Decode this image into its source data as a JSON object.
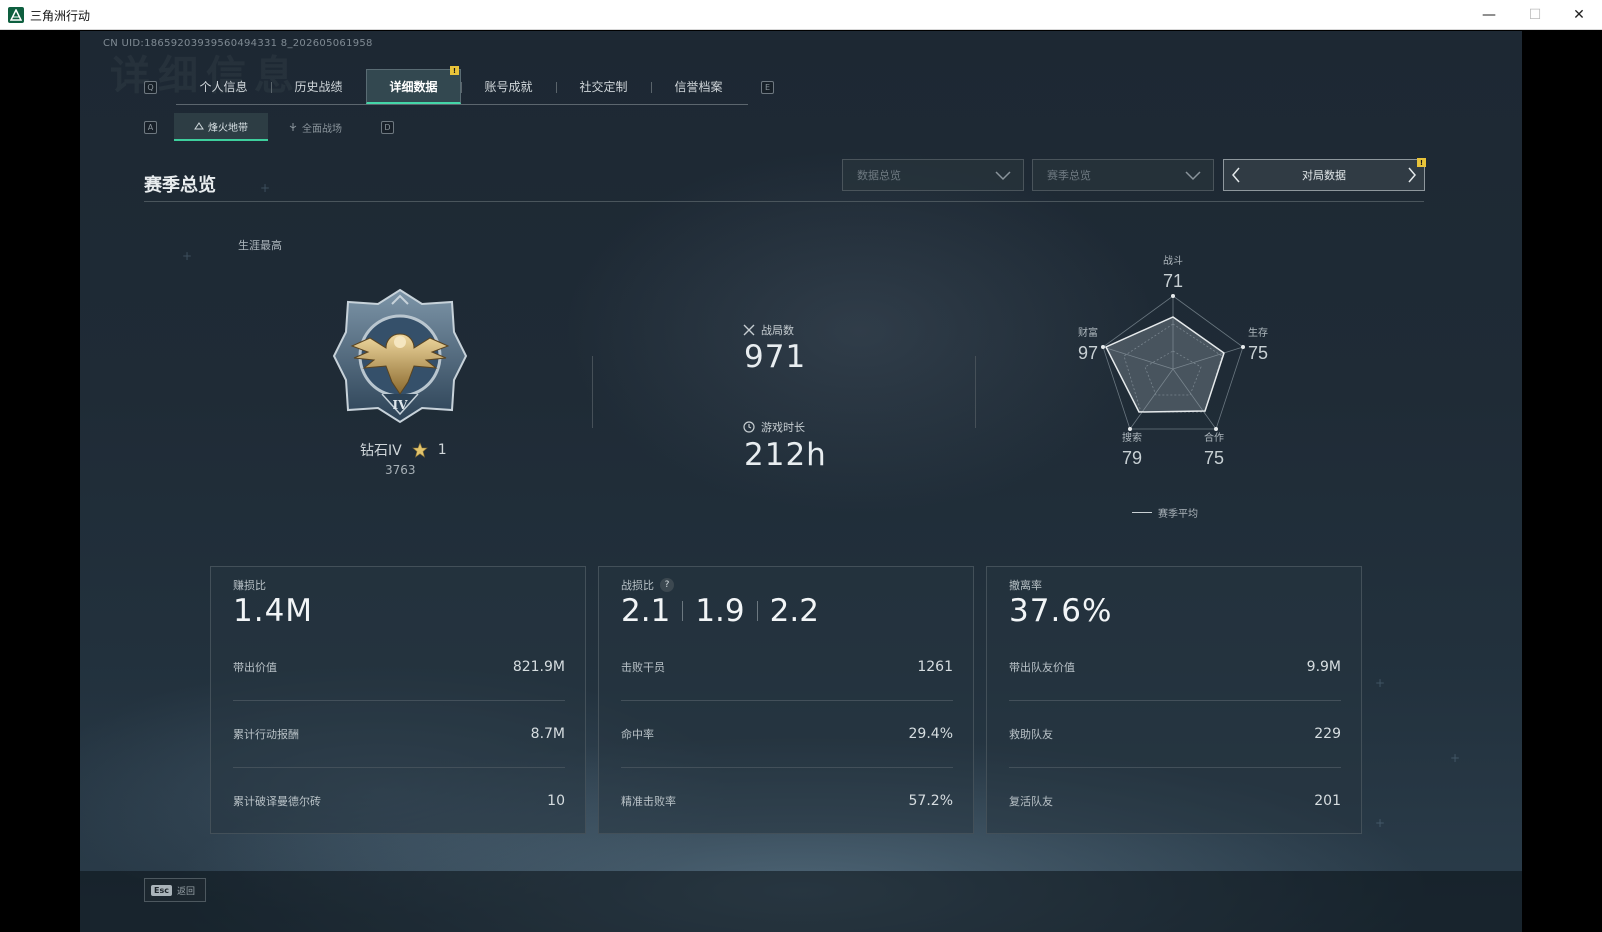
{
  "window": {
    "title": "三角洲行动",
    "min": "—",
    "max": "☐",
    "close": "✕"
  },
  "header": {
    "watermark": "详细信息",
    "uid": "CN UID:18659203939560494331 8_202605061958",
    "left_key": "Q",
    "right_key": "E"
  },
  "tabs": [
    {
      "label": "个人信息"
    },
    {
      "label": "历史战绩"
    },
    {
      "label": "详细数据",
      "active": true,
      "badge": "!"
    },
    {
      "label": "账号成就"
    },
    {
      "label": "社交定制"
    },
    {
      "label": "信誉档案"
    }
  ],
  "subtabs": {
    "left_key": "A",
    "right_key": "D",
    "items": [
      {
        "label": "烽火地带",
        "active": true
      },
      {
        "label": "全面战场"
      }
    ]
  },
  "section": {
    "title": "赛季总览",
    "select1_placeholder": "数据总览",
    "select2_placeholder": "赛季总览",
    "pager_label": "对局数据",
    "pager_badge": "!"
  },
  "career": {
    "label": "生涯最高",
    "rank_name": "钻石IV",
    "stars": "1",
    "points": "3763",
    "medal_numeral": "IV"
  },
  "stats": {
    "matches_label": "战局数",
    "matches_value": "971",
    "playtime_label": "游戏时长",
    "playtime_value": "212h"
  },
  "radar": {
    "legend": "赛季平均",
    "axes": [
      {
        "label": "战斗",
        "value": "71"
      },
      {
        "label": "生存",
        "value": "75"
      },
      {
        "label": "合作",
        "value": "75"
      },
      {
        "label": "搜索",
        "value": "79"
      },
      {
        "label": "财富",
        "value": "97"
      }
    ]
  },
  "cards": [
    {
      "label": "赚损比",
      "big": "1.4M",
      "rows": [
        {
          "k": "带出价值",
          "v": "821.9M"
        },
        {
          "k": "累计行动报酬",
          "v": "8.7M"
        },
        {
          "k": "累计破译曼德尔砖",
          "v": "10"
        }
      ]
    },
    {
      "label": "战损比",
      "help": "?",
      "bigs": [
        "2.1",
        "1.9",
        "2.2"
      ],
      "rows": [
        {
          "k": "击败干员",
          "v": "1261"
        },
        {
          "k": "命中率",
          "v": "29.4%"
        },
        {
          "k": "精准击败率",
          "v": "57.2%"
        }
      ]
    },
    {
      "label": "撤离率",
      "big": "37.6%",
      "rows": [
        {
          "k": "带出队友价值",
          "v": "9.9M"
        },
        {
          "k": "救助队友",
          "v": "229"
        },
        {
          "k": "复活队友",
          "v": "201"
        }
      ]
    }
  ],
  "footer": {
    "esc_key": "Esc",
    "esc_label": "返回"
  }
}
